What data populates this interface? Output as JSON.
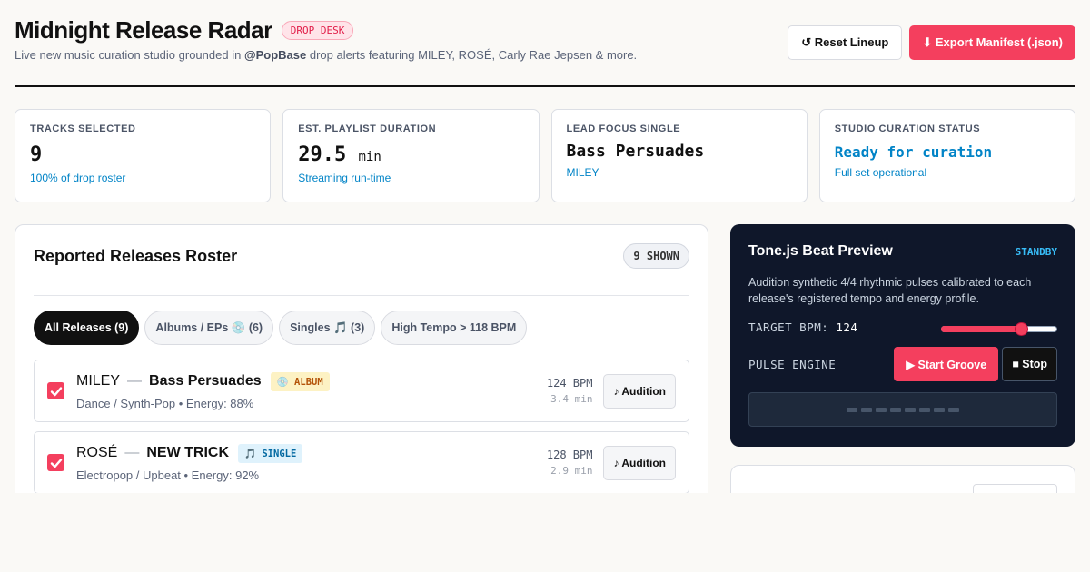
{
  "header": {
    "title": "Midnight Release Radar",
    "badge": "DROP DESK",
    "subtitle_prefix": "Live new music curation studio grounded in ",
    "subtitle_handle": "@PopBase",
    "subtitle_suffix": " drop alerts featuring MILEY, ROSÉ, Carly Rae Jepsen & more.",
    "reset_label": "↺ Reset Lineup",
    "export_label": "⬇ Export Manifest (.json)"
  },
  "stats": [
    {
      "label": "TRACKS SELECTED",
      "value": "9",
      "unit": "",
      "sub": "100% of drop roster"
    },
    {
      "label": "EST. PLAYLIST DURATION",
      "value": "29.5",
      "unit": "min",
      "sub": "Streaming run-time"
    },
    {
      "label": "LEAD FOCUS SINGLE",
      "value": "Bass Persuades",
      "unit": "",
      "sub": "MILEY"
    },
    {
      "label": "STUDIO CURATION STATUS",
      "value": "Ready for curation",
      "unit": "",
      "sub": "Full set operational"
    }
  ],
  "roster": {
    "title": "Reported Releases Roster",
    "count": "9 SHOWN",
    "filters": [
      {
        "label": "All Releases (9)",
        "active": true
      },
      {
        "label": "Albums / EPs 💿 (6)",
        "active": false
      },
      {
        "label": "Singles 🎵 (3)",
        "active": false
      },
      {
        "label": "High Tempo > 118 BPM",
        "active": false
      }
    ],
    "separator": "—",
    "audition_label": "♪ Audition",
    "rows": [
      {
        "artist": "MILEY",
        "track": "Bass Persuades",
        "tag": "💿 ALBUM",
        "tag_type": "album",
        "meta": "Dance / Synth-Pop • Energy: 88%",
        "bpm": "124 BPM",
        "duration": "3.4 min",
        "checked": true
      },
      {
        "artist": "ROSÉ",
        "track": "NEW TRICK",
        "tag": "🎵 SINGLE",
        "tag_type": "single",
        "meta": "Electropop / Upbeat • Energy: 92%",
        "bpm": "128 BPM",
        "duration": "2.9 min",
        "checked": true
      }
    ]
  },
  "beat": {
    "title": "Tone.js Beat Preview",
    "status": "STANDBY",
    "description": "Audition synthetic 4/4 rhythmic pulses calibrated to each release's registered tempo and energy profile.",
    "bpm_label": "TARGET BPM:",
    "bpm_value": "124",
    "slider_fraction": 0.69,
    "engine_label": "PULSE ENGINE",
    "start_label": "▶ Start Groove",
    "stop_label": "■ Stop",
    "pulse_count": 8
  },
  "colors": {
    "accent": "#f43f5e",
    "info": "#0284c7",
    "dark_panel": "#0f172a"
  }
}
